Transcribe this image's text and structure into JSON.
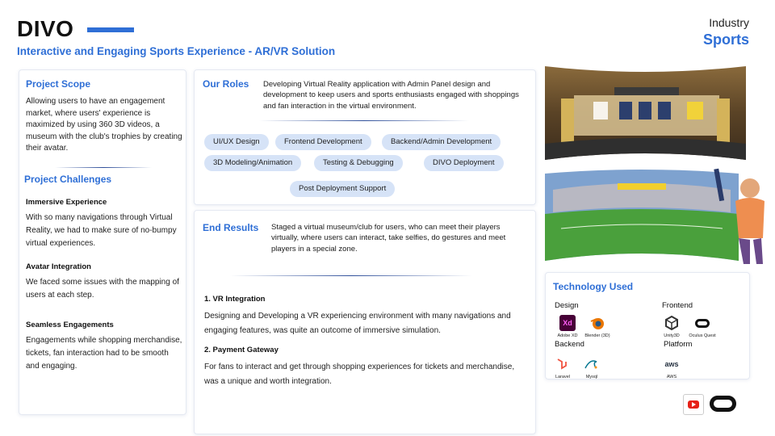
{
  "header": {
    "brand": "DIVO",
    "subtitle": "Interactive and Engaging Sports Experience - AR/VR Solution",
    "industry_label": "Industry",
    "industry_value": "Sports"
  },
  "scope": {
    "title": "Project Scope",
    "text": "Allowing users to have an engagement market, where users' experience is maximized by using 360 3D videos, a museum with the club's trophies by creating their avatar."
  },
  "challenges": {
    "title": "Project Challenges",
    "items": [
      {
        "title": "Immersive Experience",
        "text": "With so many navigations through Virtual Reality, we had to make sure of no-bumpy virtual experiences."
      },
      {
        "title": "Avatar Integration",
        "text": "We faced some issues with the mapping of users at each step."
      },
      {
        "title": "Seamless Engagements",
        "text": "Engagements while shopping merchandise, tickets, fan interaction had to be smooth and engaging."
      }
    ]
  },
  "roles": {
    "title": "Our Roles",
    "text": "Developing Virtual Reality application with Admin Panel design and development to keep users and sports enthusiasts engaged with shoppings and fan interaction in the virtual environment.",
    "chips": [
      "UI/UX Design",
      "Frontend Development",
      "Backend/Admin Development",
      "3D Modeling/Animation",
      "Testing & Debugging",
      "DIVO Deployment",
      "Post Deployment Support"
    ]
  },
  "results": {
    "title": "End Results",
    "text": "Staged a virtual museum/club for users, who can meet their players virtually, where users can interact, take selfies, do gestures and meet players in a special zone.",
    "items": [
      {
        "title": "1. VR Integration",
        "text": "Designing and Developing a VR experiencing environment with many navigations and engaging features, was quite an outcome of immersive simulation."
      },
      {
        "title": "2. Payment Gateway",
        "text": "For fans to interact and get through shopping experiences for tickets and merchandise, was a unique and worth integration."
      }
    ]
  },
  "tech": {
    "title": "Technology Used",
    "design": {
      "label": "Design",
      "tools": [
        "Adobe XD",
        "Blender (3D)"
      ]
    },
    "frontend": {
      "label": "Frontend",
      "tools": [
        "Unity3D",
        "Oculus Quest"
      ]
    },
    "backend": {
      "label": "Backend",
      "tools": [
        "Laravel",
        "Mysql"
      ]
    },
    "platform": {
      "label": "Platform",
      "tools": [
        "AWS"
      ]
    },
    "icon_text": {
      "xd": "Xd",
      "aws": "aws"
    }
  },
  "colors": {
    "accent": "#2f6fd6",
    "chip_bg": "#d6e3f7"
  },
  "icons": [
    "youtube-icon",
    "oculus-icon"
  ]
}
